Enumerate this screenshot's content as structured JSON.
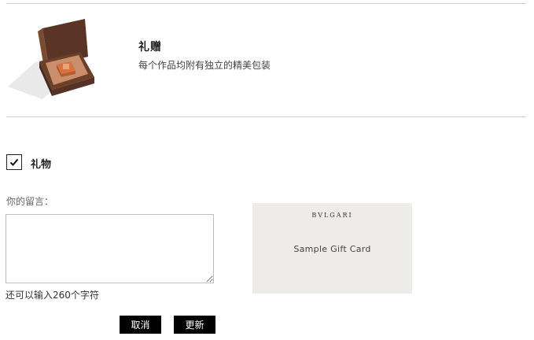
{
  "gift_section": {
    "title": "礼赠",
    "description": "每个作品均附有独立的精美包装",
    "image_icon": "gift-box-image"
  },
  "gift_option": {
    "checked": true,
    "label": "礼物",
    "icon": "checkmark-icon"
  },
  "message": {
    "label": "你的留言：",
    "value": "",
    "placeholder": "",
    "remaining_text": "还可以输入260个字符"
  },
  "actions": {
    "cancel_label": "取消",
    "update_label": "更新"
  },
  "gift_card": {
    "brand": "BVLGARI",
    "text": "Sample Gift Card"
  },
  "colors": {
    "divider": "#cfcfcf",
    "button_bg": "#000000",
    "card_bg": "#eeece9",
    "box_brown": "#6b3f2a"
  }
}
